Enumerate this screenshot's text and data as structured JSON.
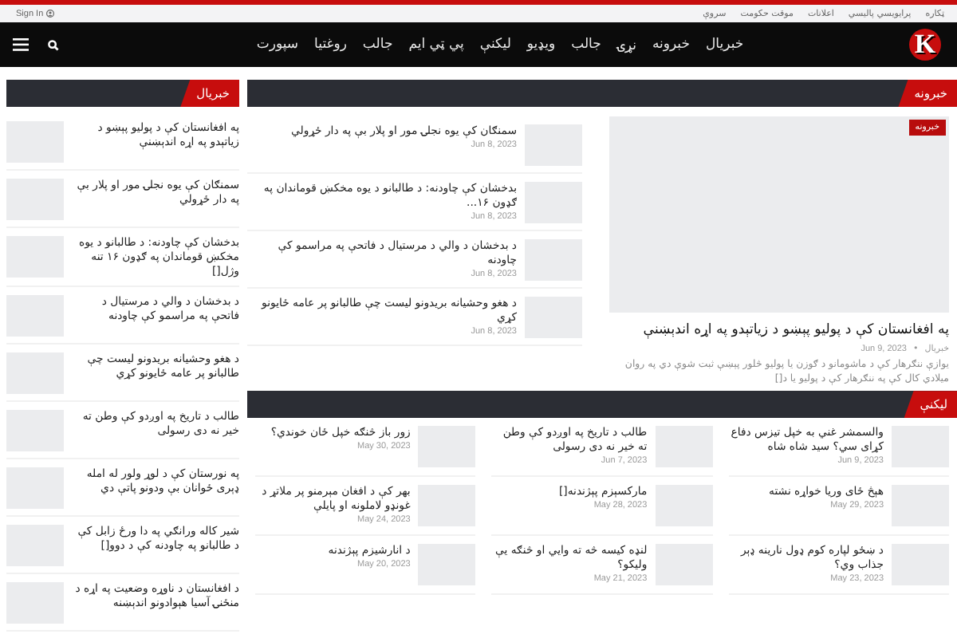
{
  "top_bar": {
    "links": [
      "ټکاره",
      "پرایویسي پالیسي",
      "اعلانات",
      "موقت حکومت",
      "سروې"
    ],
    "sign_in": "Sign In"
  },
  "nav": {
    "logo": "K",
    "items": [
      "خبریال",
      "خبرونه",
      "نړۍ",
      "جالب",
      "ویډیو",
      "لیکنې",
      "پي ټي ایم",
      "جالب",
      "روغتیا",
      "سپورت"
    ]
  },
  "news_section": {
    "title": "خبرونه",
    "featured": {
      "tag": "خبرونه",
      "title": "په افغانستان کې د پولیو پېښو د زیاتېدو په اړه اندېښنې",
      "author": "خبریال",
      "separator": "•",
      "date": "Jun 9, 2023",
      "excerpt": "یوازې ننګرهار کې د ماشومانو د ګوزن یا پولیو څلور پېښې ثبت شوې دي په روان میلادي کال کې په ننګرهار کې د پولیو یا د[]"
    },
    "items": [
      {
        "title": "سمنګان کې یوه نجلۍ مور او پلار بې په دار ځړولي",
        "date": "Jun 8, 2023"
      },
      {
        "title": "بدخشان کې چاودنه: د طالبانو د یوه مخکښ قوماندان په ګډون ۱۶...",
        "date": "Jun 8, 2023"
      },
      {
        "title": "د بدخشان د والي د مرستیال د فاتحې په مراسمو کې چاودنه",
        "date": "Jun 8, 2023"
      },
      {
        "title": "د هغو وحشیانه بریدونو لیست چې طالبانو پر عامه ځایونو کړي",
        "date": "Jun 8, 2023"
      }
    ]
  },
  "writings_section": {
    "title": "لیکنې",
    "columns": [
      {
        "items": [
          {
            "title": "والسمشر غني به خپل تيزس دفاع کړای سي؟ سید شاه شاه",
            "date": "Jun 9, 2023"
          },
          {
            "title": "هېڅ ځای وریا خواړه نشته",
            "date": "May 29, 2023"
          },
          {
            "title": "د ښځو لپاره کوم ډول نارینه ډېر جذاب وي؟",
            "date": "May 23, 2023"
          }
        ]
      },
      {
        "items": [
          {
            "title": "طالب د تاریخ په اوږدو کې وطن ته خیر نه دی رسولی",
            "date": "Jun 7, 2023"
          },
          {
            "title": "مارکسېزم پېژندنه[]",
            "date": "May 28, 2023"
          },
          {
            "title": "لنډه کیسه څه ته وایي او څنګه یې ولیکو؟",
            "date": "May 21, 2023"
          }
        ]
      },
      {
        "items": [
          {
            "title": "زور باز څنګه خپل ځان خوندي؟",
            "date": "May 30, 2023"
          },
          {
            "title": "بهر کې د افغان مېرمنو پر ملاتړ د غونډو لاملونه او پایلې",
            "date": "May 24, 2023"
          },
          {
            "title": "د انارشیزم پېژندنه",
            "date": "May 20, 2023"
          }
        ]
      }
    ]
  },
  "sidebar": {
    "title": "خبریال",
    "items": [
      {
        "title": "په افغانستان کې د پولیو پېښو د زیاتېدو په اړه اندېښنې"
      },
      {
        "title": "سمنګان کې یوه نجلۍ مور او پلار بې په دار ځړولي"
      },
      {
        "title": "بدخشان کې چاودنه: د طالبانو د یوه مخکښ قوماندان په ګډون ۱۶ تنه وژل[]"
      },
      {
        "title": "د بدخشان د والي د مرستیال د فاتحې په مراسمو کې چاودنه"
      },
      {
        "title": "د هغو وحشیانه بریدونو لیست چې طالبانو پر عامه ځایونو کړي"
      },
      {
        "title": "طالب د تاریخ په اوږدو کې وطن ته خیر نه دی رسولی"
      },
      {
        "title": "په نورستان کې د لوړ ولور له امله ډېری ځوانان بې ودونو پاتې دي"
      },
      {
        "title": "شیر کاله ورانګي په دا ورځ زابل کې د طالبانو په چاودنه کې د دوو[]"
      },
      {
        "title": "د افغانستان د ناوړه وضعیت په اړه د منځنۍ آسیا هېوادونو اندېښنه"
      }
    ]
  }
}
